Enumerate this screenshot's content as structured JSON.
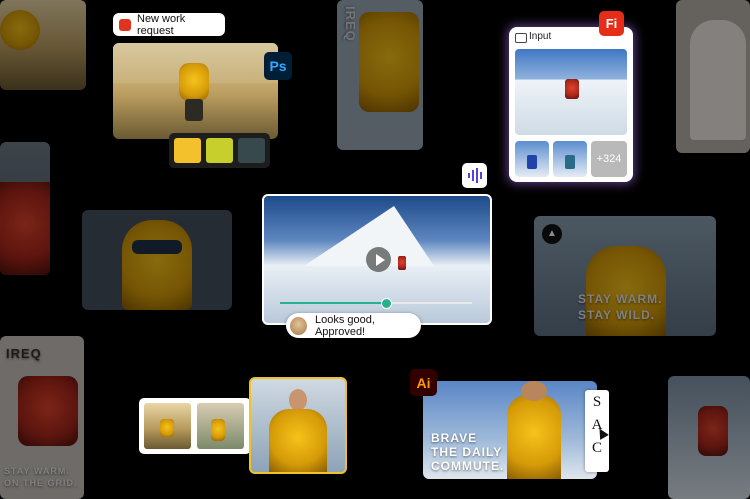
{
  "requestChip": {
    "label": "New work request"
  },
  "psBadge": {
    "label": "Ps"
  },
  "fiBadge": {
    "label": "Fi"
  },
  "aiBadge": {
    "label": "Ai"
  },
  "inputPanel": {
    "title": "Input",
    "more": "+324"
  },
  "video": {
    "comment": "Looks good, Approved!"
  },
  "adA": {
    "line1": "STAY WARM.",
    "line2": "STAY WILD."
  },
  "adB": {
    "line1": "BRAVE",
    "line2": "THE DAILY",
    "line3": "COMMUTE."
  },
  "adC": {
    "line1": "STAY WARM.",
    "line2": "ON THE GRID."
  },
  "verticalText": {
    "top": "IREQ",
    "left": "IREQ"
  },
  "letters": {
    "a": "S",
    "b": "A",
    "c": "C"
  },
  "colors": {
    "swatch1": "#f2c12b",
    "swatch2": "#c6cf2c",
    "swatch3": "#37494c",
    "accent": "#2bb08f"
  }
}
